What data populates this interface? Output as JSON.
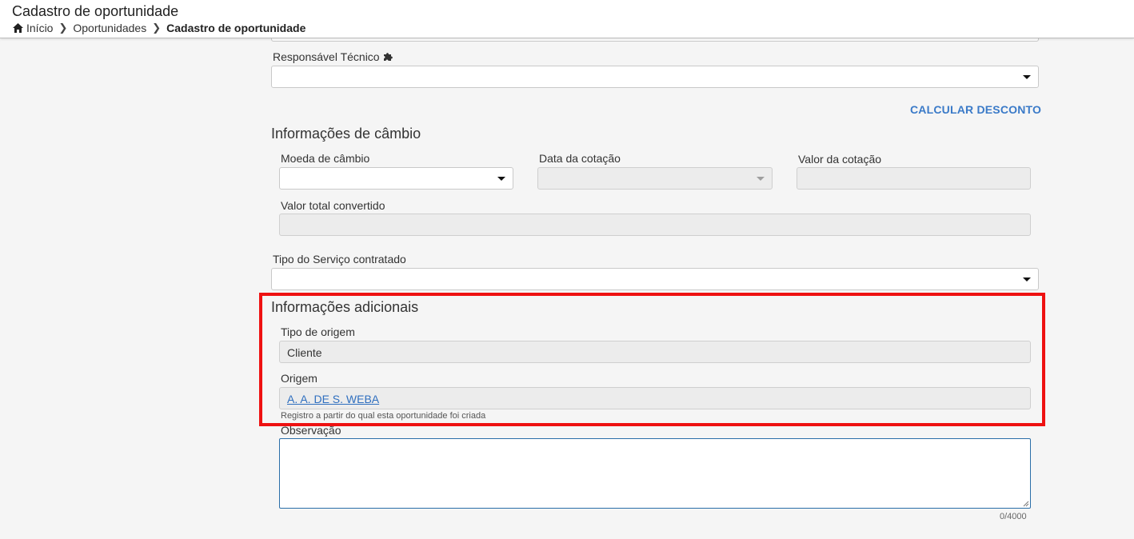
{
  "header": {
    "title": "Cadastro de oportunidade",
    "breadcrumb": [
      "Início",
      "Oportunidades",
      "Cadastro de oportunidade"
    ]
  },
  "responsavel_tecnico": {
    "label": "Responsável Técnico",
    "value": ""
  },
  "calcular_desconto": "CALCULAR DESCONTO",
  "cambio": {
    "title": "Informações de câmbio",
    "moeda_label": "Moeda de câmbio",
    "data_cotacao_label": "Data da cotação",
    "valor_cotacao_label": "Valor da cotação",
    "valor_total_label": "Valor total convertido"
  },
  "tipo_servico": {
    "label": "Tipo do Serviço contratado",
    "value": ""
  },
  "adicionais": {
    "title": "Informações adicionais",
    "tipo_origem_label": "Tipo de origem",
    "tipo_origem_value": "Cliente",
    "origem_label": "Origem",
    "origem_value": "A. A. DE S. WEBA",
    "origem_helper": "Registro a partir do qual esta oportunidade foi criada"
  },
  "observacao": {
    "label": "Observação",
    "value": "",
    "counter": "0/4000"
  },
  "colors": {
    "highlight": "#ee1111",
    "link": "#3a7ac8",
    "focus_border": "#2a6ea8"
  }
}
